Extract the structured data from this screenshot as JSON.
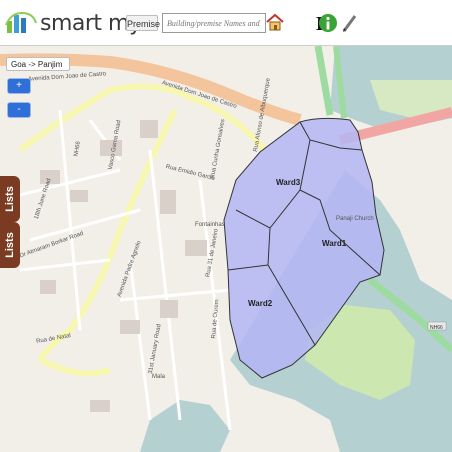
{
  "app": {
    "brand": "smart my"
  },
  "toolbar": {
    "premise_label": "Premise",
    "search_placeholder": "Building/premise Names and No...",
    "icons": [
      "home-icon",
      "layer-l-icon",
      "info-icon",
      "pencil-icon"
    ]
  },
  "map": {
    "location_breadcrumb": "Goa -> Panjim",
    "zoom_in": "+",
    "zoom_out": "-",
    "lists_tab": "Lists",
    "wards": [
      "Ward3",
      "Ward1",
      "Ward2"
    ],
    "road_labels": [
      "Avenida Dom Joao de Castro",
      "Avenida Dom Joao de Castro",
      "Rua Cunha Gonsalves",
      "Rua Emidio Garcia",
      "Fontainhas",
      "Rua 31 de Janeiro",
      "Rua de Ourem",
      "18th June Road",
      "Dr Atmaram Borkar Road",
      "Avenida Padre Agnelo",
      "Mala",
      "31st January Road",
      "Panaji Church",
      "NH66",
      "Vasco Gama Road",
      "Rua de Natal",
      "Rua Afonso de Albuquerque"
    ],
    "colors": {
      "ward_fill": "#b4b6f5",
      "ward_stroke": "#333333",
      "water": "#b5d0d0",
      "park": "#cde7b1",
      "main_road": "#f4c59c",
      "secondary_road": "#f7f7b0",
      "highway": "#9edba0"
    }
  }
}
